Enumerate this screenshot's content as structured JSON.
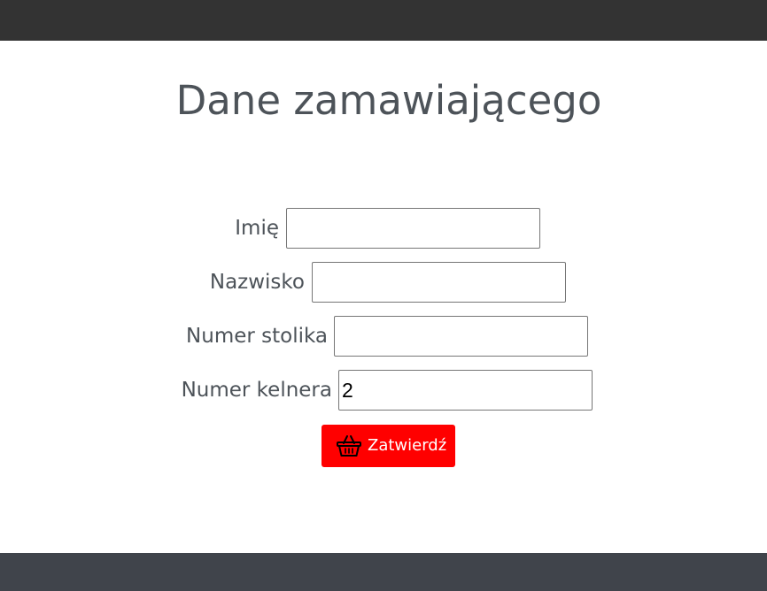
{
  "header": {
    "title": ""
  },
  "page": {
    "title": "Dane zamawiającego"
  },
  "form": {
    "fields": [
      {
        "label": "Imię",
        "value": ""
      },
      {
        "label": "Nazwisko",
        "value": ""
      },
      {
        "label": "Numer stolika",
        "value": ""
      },
      {
        "label": "Numer kelnera",
        "value": "2"
      }
    ],
    "submit": {
      "label": "Zatwierdź",
      "icon": "basket-icon"
    }
  },
  "colors": {
    "topbar": "#333333",
    "footer": "#40444b",
    "accent": "#ff0000",
    "text": "#4d5359"
  }
}
